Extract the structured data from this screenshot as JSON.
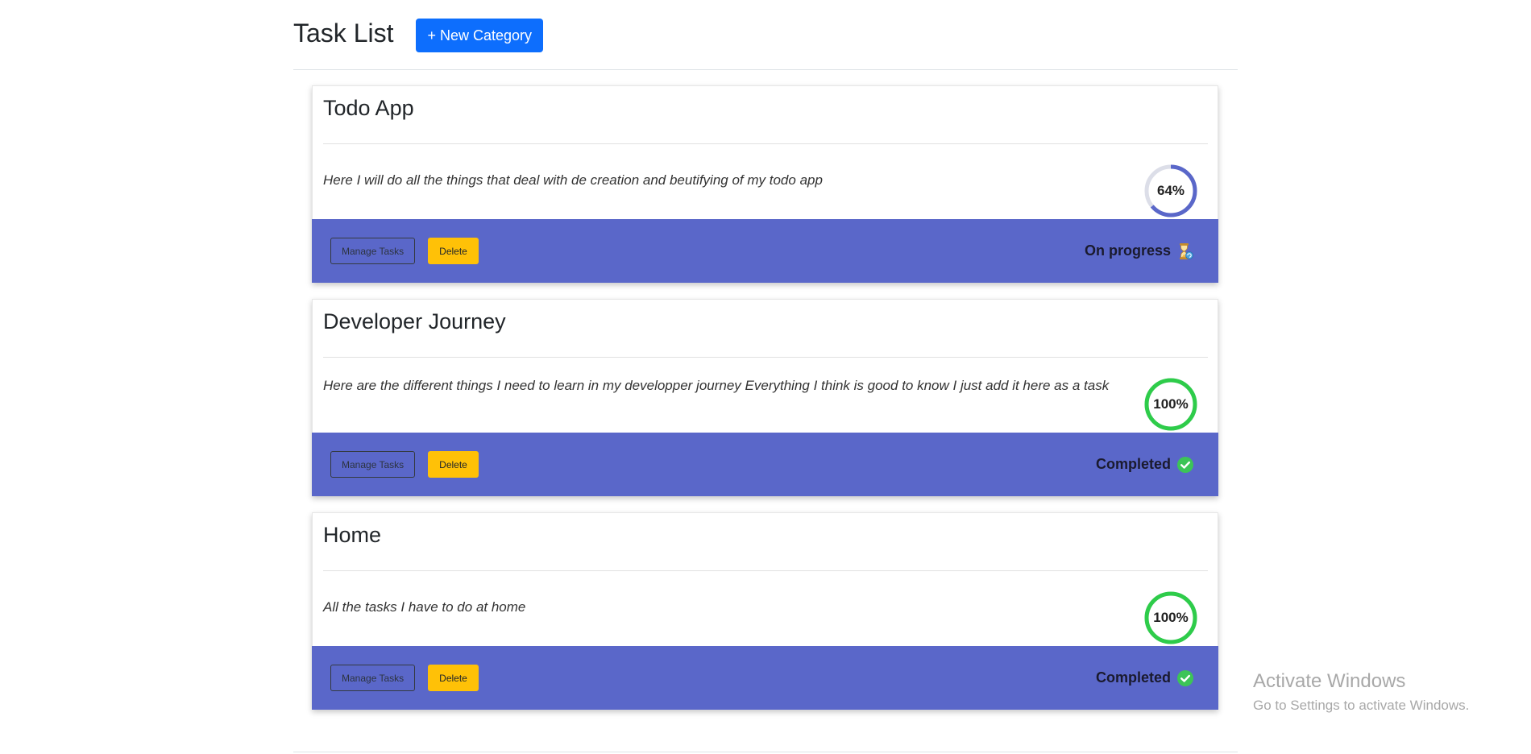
{
  "header": {
    "title": "Task List",
    "new_category_label": "+ New Category"
  },
  "cards": [
    {
      "title": "Todo App",
      "description": "Here I will do all the things that deal with de creation and beutifying of my todo app",
      "progress": 64,
      "progress_label": "64%",
      "progress_color": "#5a67c9",
      "manage_label": "Manage Tasks",
      "delete_label": "Delete",
      "status": "On progress",
      "status_icon": "hourglass-icon"
    },
    {
      "title": "Developer Journey",
      "description": "Here are the different things I need to learn in my developper journey Everything I think is good to know I just add it here as a task",
      "progress": 100,
      "progress_label": "100%",
      "progress_color": "#2ecc4a",
      "manage_label": "Manage Tasks",
      "delete_label": "Delete",
      "status": "Completed",
      "status_icon": "check-circle-icon"
    },
    {
      "title": "Home",
      "description": "All the tasks I have to do at home",
      "progress": 100,
      "progress_label": "100%",
      "progress_color": "#2ecc4a",
      "manage_label": "Manage Tasks",
      "delete_label": "Delete",
      "status": "Completed",
      "status_icon": "check-circle-icon"
    }
  ],
  "colors": {
    "primary": "#0d6efd",
    "card_footer": "#5a67c9",
    "delete": "#ffc107",
    "ring_track": "#dcdee8"
  },
  "watermark": {
    "title": "Activate Windows",
    "subtitle": "Go to Settings to activate Windows."
  }
}
